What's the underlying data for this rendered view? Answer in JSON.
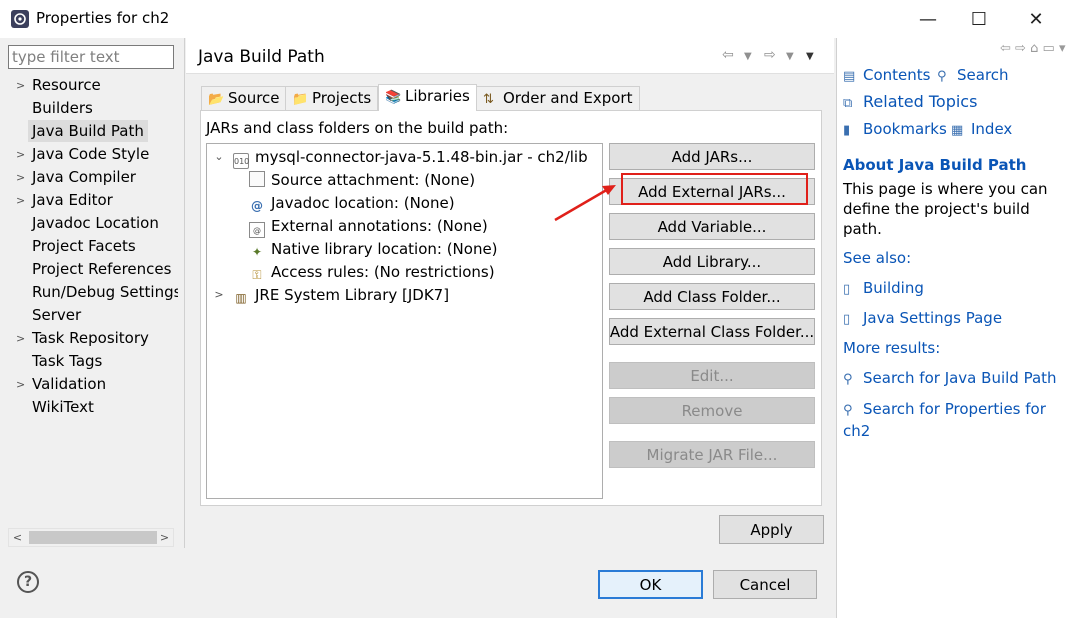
{
  "window": {
    "title": "Properties for ch2",
    "controls": {
      "minimize": "—",
      "maximize": "☐",
      "close": "✕"
    }
  },
  "filter": {
    "placeholder": "type filter text",
    "value": ""
  },
  "nav": {
    "items": [
      {
        "label": "Resource",
        "expandable": true
      },
      {
        "label": "Builders",
        "expandable": false
      },
      {
        "label": "Java Build Path",
        "expandable": false,
        "selected": true
      },
      {
        "label": "Java Code Style",
        "expandable": true
      },
      {
        "label": "Java Compiler",
        "expandable": true
      },
      {
        "label": "Java Editor",
        "expandable": true
      },
      {
        "label": "Javadoc Location",
        "expandable": false
      },
      {
        "label": "Project Facets",
        "expandable": false
      },
      {
        "label": "Project References",
        "expandable": false
      },
      {
        "label": "Run/Debug Settings",
        "expandable": false
      },
      {
        "label": "Server",
        "expandable": false
      },
      {
        "label": "Task Repository",
        "expandable": true
      },
      {
        "label": "Task Tags",
        "expandable": false
      },
      {
        "label": "Validation",
        "expandable": true
      },
      {
        "label": "WikiText",
        "expandable": false
      }
    ]
  },
  "page": {
    "title": "Java Build Path",
    "tabs": [
      {
        "label": "Source",
        "icon": "source-folder-icon"
      },
      {
        "label": "Projects",
        "icon": "projects-icon"
      },
      {
        "label": "Libraries",
        "icon": "libraries-icon",
        "active": true
      },
      {
        "label": "Order and Export",
        "icon": "order-export-icon"
      }
    ],
    "panel_label": "JARs and class folders on the build path:",
    "library_tree": {
      "jar": "mysql-connector-java-5.1.48-bin.jar - ch2/lib",
      "children": [
        "Source attachment: (None)",
        "Javadoc location: (None)",
        "External annotations: (None)",
        "Native library location: (None)",
        "Access rules: (No restrictions)"
      ],
      "jre": "JRE System Library [JDK7]"
    },
    "buttons": [
      {
        "label": "Add JARs...",
        "enabled": true
      },
      {
        "label": "Add External JARs...",
        "enabled": true,
        "highlighted": true
      },
      {
        "label": "Add Variable...",
        "enabled": true
      },
      {
        "label": "Add Library...",
        "enabled": true
      },
      {
        "label": "Add Class Folder...",
        "enabled": true
      },
      {
        "label": "Add External Class Folder...",
        "enabled": true
      },
      {
        "label": "Edit...",
        "enabled": false
      },
      {
        "label": "Remove",
        "enabled": false
      },
      {
        "label": "Migrate JAR File...",
        "enabled": false
      }
    ],
    "apply_label": "Apply"
  },
  "footer": {
    "ok_label": "OK",
    "cancel_label": "Cancel",
    "help_icon": "?"
  },
  "help": {
    "nav": {
      "contents": "Contents",
      "search": "Search",
      "related_topics": "Related Topics",
      "bookmarks": "Bookmarks",
      "index": "Index"
    },
    "title": "About Java Build Path",
    "description": "This page is where you can define the project's build path.",
    "see_also_label": "See also:",
    "see_also": [
      "Building",
      "Java Settings Page"
    ],
    "more_results_label": "More results:",
    "more_results": [
      "Search for Java Build Path",
      "Search for Properties for ch2"
    ]
  },
  "colors": {
    "accent": "#0a55b6",
    "highlight": "#e0201a",
    "selection": "#dcdcdc"
  }
}
